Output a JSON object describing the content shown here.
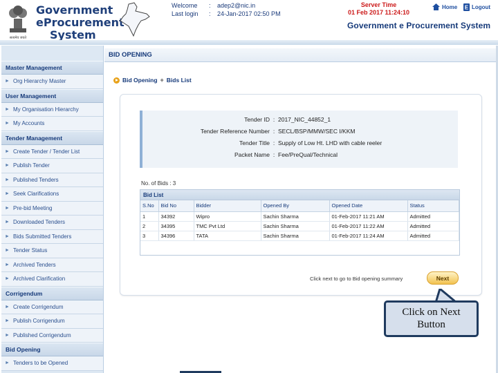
{
  "header": {
    "logo_line1": "Government",
    "logo_line2": "eProcurement",
    "logo_line3": "System",
    "emblem_caption": "सत्यमेव जयते",
    "welcome_label": "Welcome",
    "welcome_sep": ":",
    "welcome_value": "adep2@nic.in",
    "lastlogin_label": "Last login",
    "lastlogin_sep": ":",
    "lastlogin_value": "24-Jan-2017 02:50 PM",
    "server_time_label": "Server Time",
    "server_time_value": "01 Feb 2017 11:24:10",
    "home_label": "Home",
    "logout_label": "Logout",
    "portal_title": "Government e Procurement System"
  },
  "sidebar": {
    "sections": [
      {
        "title": "Master Management",
        "items": [
          "Org Hierarchy Master"
        ]
      },
      {
        "title": "User Management",
        "items": [
          "My Organisation Hierarchy",
          "My Accounts"
        ]
      },
      {
        "title": "Tender Management",
        "items": [
          "Create Tender / Tender List",
          "Publish Tender",
          "Published Tenders",
          "Seek Clarifications",
          "Pre-bid Meeting",
          "Downloaded Tenders",
          "Bids Submitted Tenders",
          "Tender Status",
          "Archived Tenders",
          "Archived Clarification"
        ]
      },
      {
        "title": "Corrigendum",
        "items": [
          "Create Corrigendum",
          "Publish Corrigendum",
          "Published Corrigendum"
        ]
      },
      {
        "title": "Bid Opening",
        "items": [
          "Tenders to be Opened"
        ]
      }
    ]
  },
  "main": {
    "tab_title": "BID OPENING",
    "breadcrumb": [
      "Bid Opening",
      "Bids List"
    ],
    "tender": {
      "id_label": "Tender ID",
      "id_value": "2017_NIC_44852_1",
      "ref_label": "Tender Reference Number",
      "ref_value": "SECL/BSP/MMW/SEC I/KKM",
      "title_label": "Tender Title",
      "title_value": "Supply of Low Ht. LHD with cable reeler",
      "packet_label": "Packet Name",
      "packet_value": "Fee/PreQual/Technical",
      "sep": ":"
    },
    "bids_count_label": "No. of Bids : 3",
    "bid_list_title": "Bid List",
    "columns": [
      "S.No",
      "Bid No",
      "Bidder",
      "Opened By",
      "Opened Date",
      "Status"
    ],
    "rows": [
      [
        "1",
        "34392",
        "Wipro",
        "Sachin Sharma",
        "01-Feb-2017 11:21 AM",
        "Admitted"
      ],
      [
        "2",
        "34395",
        "TMC Pvt Ltd",
        "Sachin Sharma",
        "01-Feb-2017 11:22 AM",
        "Admitted"
      ],
      [
        "3",
        "34396",
        "TATA",
        "Sachin Sharma",
        "01-Feb-2017 11:24 AM",
        "Admitted"
      ]
    ],
    "next_hint": "Click next to go to Bid opening summary",
    "next_label": "Next"
  },
  "callout": {
    "line1": "Click on Next",
    "line2": "Button"
  },
  "colors": {
    "brand_blue": "#163a7a",
    "server_time_red": "#cc1a1a",
    "next_button": "#f2c250",
    "callout_bg": "#d6dfec"
  }
}
